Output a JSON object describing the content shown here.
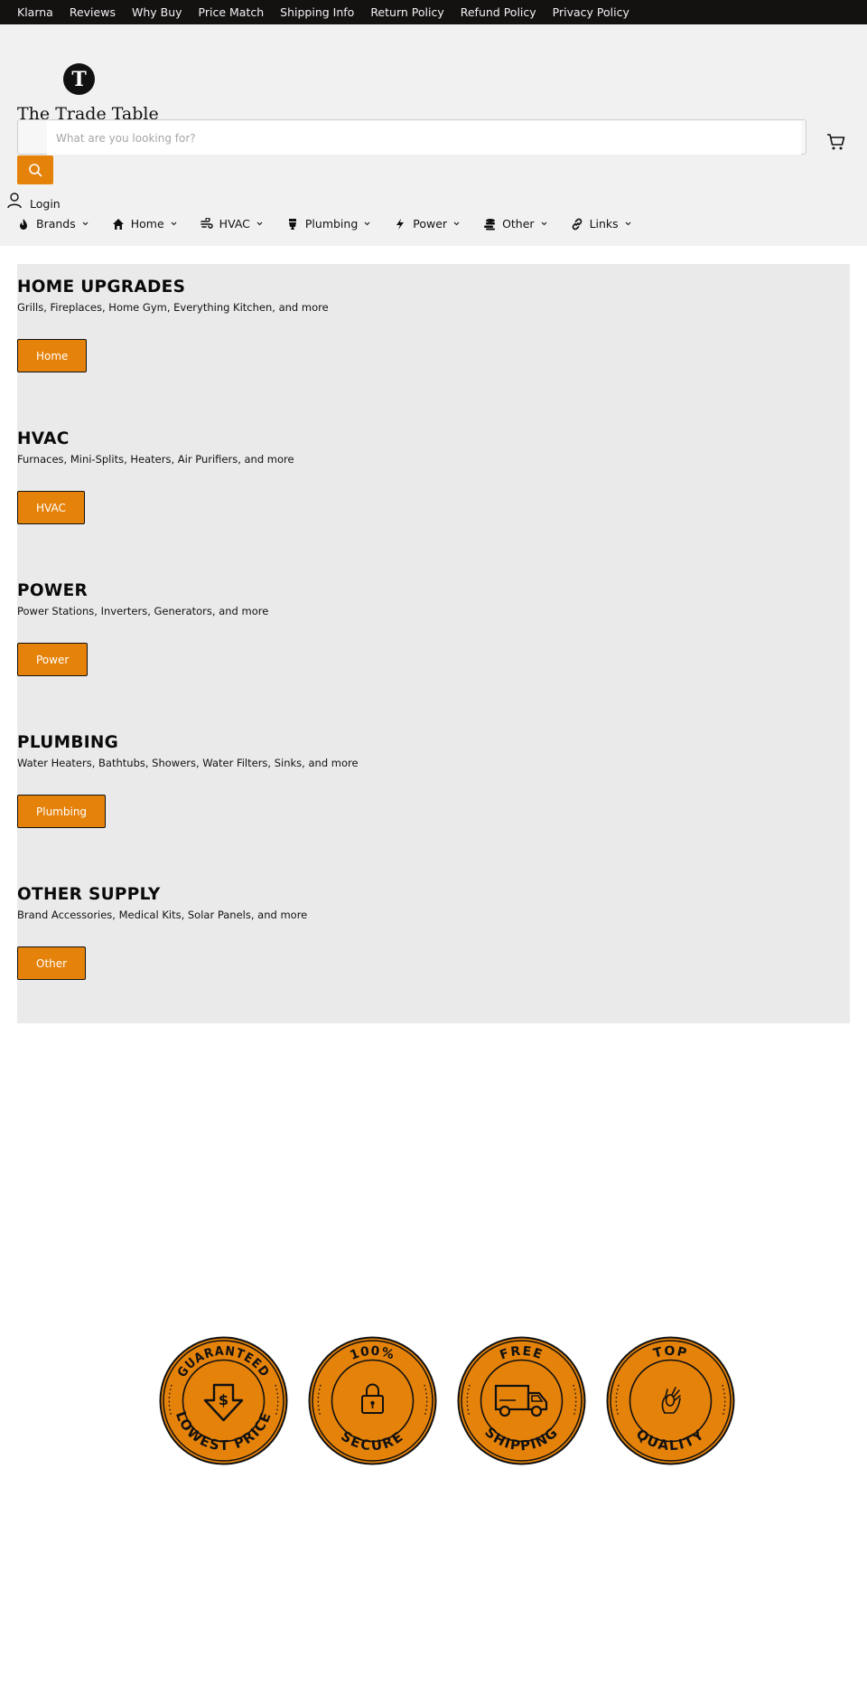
{
  "topbar": {
    "links": [
      "Klarna",
      "Reviews",
      "Why Buy",
      "Price Match",
      "Shipping Info",
      "Return Policy",
      "Refund Policy",
      "Privacy Policy"
    ]
  },
  "header": {
    "logo_letter": "T",
    "logo_text": "The Trade Table",
    "search_placeholder": "What are you looking for?",
    "login_label": "Login"
  },
  "nav": {
    "items": [
      {
        "label": "Brands",
        "icon": "fire-icon"
      },
      {
        "label": "Home",
        "icon": "house-icon"
      },
      {
        "label": "HVAC",
        "icon": "fan-icon"
      },
      {
        "label": "Plumbing",
        "icon": "toilet-icon"
      },
      {
        "label": "Power",
        "icon": "bolt-icon"
      },
      {
        "label": "Other",
        "icon": "coins-icon"
      },
      {
        "label": "Links",
        "icon": "link-icon"
      }
    ]
  },
  "sections": [
    {
      "title": "HOME UPGRADES",
      "desc": "Grills, Fireplaces, Home Gym, Everything Kitchen, and more",
      "button": "Home"
    },
    {
      "title": "HVAC",
      "desc": "Furnaces, Mini-Splits, Heaters, Air Purifiers, and more",
      "button": "HVAC"
    },
    {
      "title": "POWER",
      "desc": "Power Stations, Inverters, Generators, and more",
      "button": "Power"
    },
    {
      "title": "PLUMBING",
      "desc": "Water Heaters, Bathtubs, Showers, Water Filters, Sinks, and more",
      "button": "Plumbing"
    },
    {
      "title": "OTHER SUPPLY",
      "desc": "Brand Accessories, Medical Kits, Solar Panels, and more",
      "button": "Other"
    }
  ],
  "badges": [
    {
      "top": "GUARANTEED",
      "bottom": "LOWEST PRICE",
      "icon": "price-down-arrow-icon"
    },
    {
      "top": "100%",
      "bottom": "SECURE",
      "icon": "padlock-icon"
    },
    {
      "top": "FREE",
      "bottom": "SHIPPING",
      "icon": "truck-icon"
    },
    {
      "top": "TOP",
      "bottom": "QUALITY",
      "icon": "ok-hand-icon"
    }
  ],
  "colors": {
    "accent": "#e5820a",
    "topbar_bg": "#141111",
    "header_bg": "#f1f1f1",
    "section_bg": "#eaeaea"
  }
}
